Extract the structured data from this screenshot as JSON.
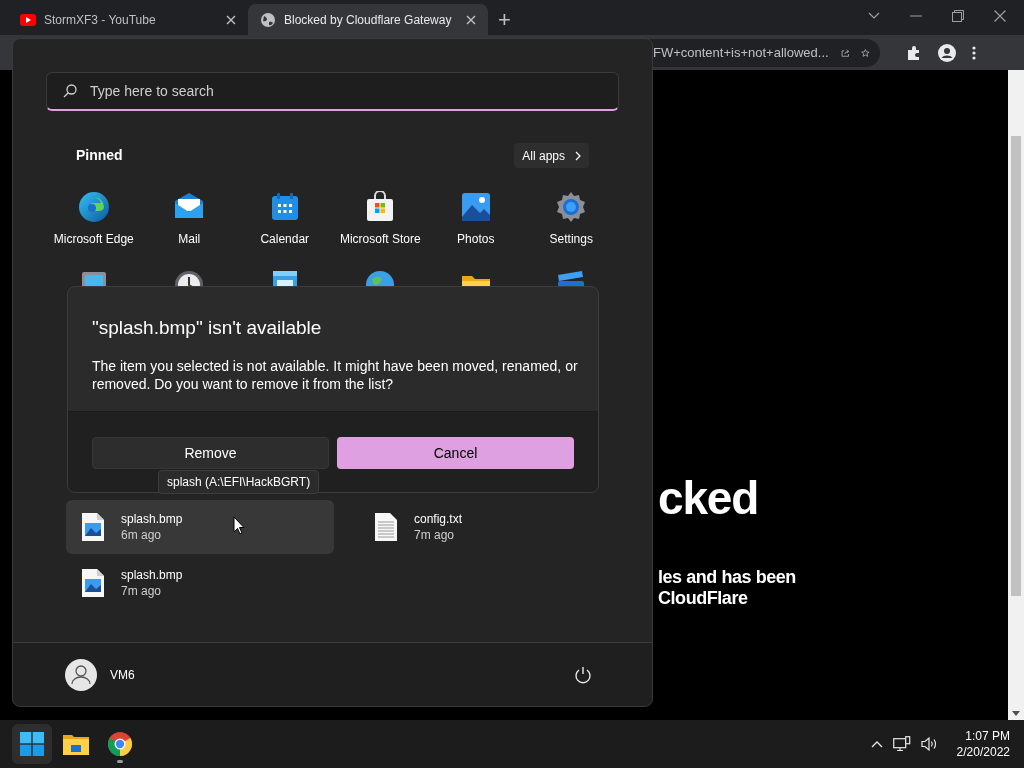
{
  "browser": {
    "tabs": [
      {
        "title": "StormXF3 - YouTube",
        "kind": "youtube",
        "selected": false
      },
      {
        "title": "Blocked by Cloudflare Gateway",
        "kind": "globe",
        "selected": true
      }
    ],
    "new_tab": "+",
    "address": "FW+content+is+not+allowed...",
    "page": {
      "heading": "cked",
      "lines": [
        "les and has been",
        "CloudFlare"
      ]
    }
  },
  "start_menu": {
    "search": {
      "placeholder": "Type here to search"
    },
    "pinned_title": "Pinned",
    "all_apps": "All apps",
    "pinned": [
      {
        "label": "Microsoft Edge",
        "kind": "edge"
      },
      {
        "label": "Mail",
        "kind": "mail"
      },
      {
        "label": "Calendar",
        "kind": "calendar"
      },
      {
        "label": "Microsoft Store",
        "kind": "store"
      },
      {
        "label": "Photos",
        "kind": "photos"
      },
      {
        "label": "Settings",
        "kind": "settings"
      }
    ],
    "pinned_row_2": [
      {
        "kind": "monitor"
      },
      {
        "kind": "clock"
      },
      {
        "kind": "notepad"
      },
      {
        "kind": "globe"
      },
      {
        "kind": "folder"
      },
      {
        "kind": "clapper"
      }
    ],
    "dialog": {
      "title": "\"splash.bmp\" isn't available",
      "message": "The item you selected is not available. It might have been moved, renamed, or removed. Do you want to remove it from the list?",
      "buttons": [
        {
          "label": "Remove",
          "kind": "secondary"
        },
        {
          "label": "Cancel",
          "kind": "primary"
        }
      ]
    },
    "tooltip": "splash (A:\\EFI\\HackBGRT)",
    "recommended": [
      {
        "name": "splash.bmp",
        "time": "6m ago",
        "kind": "image",
        "selected": true
      },
      {
        "name": "config.txt",
        "time": "7m ago",
        "kind": "text",
        "selected": false
      },
      {
        "name": "splash.bmp",
        "time": "7m ago",
        "kind": "image",
        "selected": false
      }
    ],
    "user": "VM6"
  },
  "taskbar": {
    "apps": [
      {
        "kind": "start",
        "selected": true,
        "running": false
      },
      {
        "kind": "explorer",
        "selected": false,
        "running": false
      },
      {
        "kind": "chrome",
        "selected": false,
        "running": true
      }
    ],
    "time": "1:07 PM",
    "date": "2/20/2022"
  }
}
